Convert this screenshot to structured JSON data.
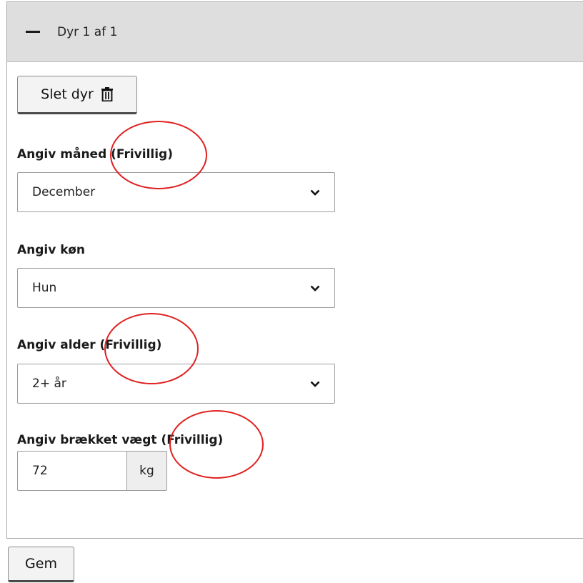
{
  "panel": {
    "title": "Dyr 1 af 1",
    "collapse_icon": "minus-icon"
  },
  "delete_button": {
    "label": "Slet dyr",
    "icon": "trash-icon"
  },
  "fields": {
    "month": {
      "label": "Angiv måned (Frivillig)",
      "value": "December"
    },
    "sex": {
      "label": "Angiv køn",
      "value": "Hun"
    },
    "age": {
      "label": "Angiv alder (Frivillig)",
      "value": "2+ år"
    },
    "weight": {
      "label": "Angiv brækket vægt (Frivillig)",
      "value": "72",
      "unit": "kg"
    }
  },
  "save_button": {
    "label": "Gem"
  },
  "annotation": {
    "color": "#e02020"
  }
}
